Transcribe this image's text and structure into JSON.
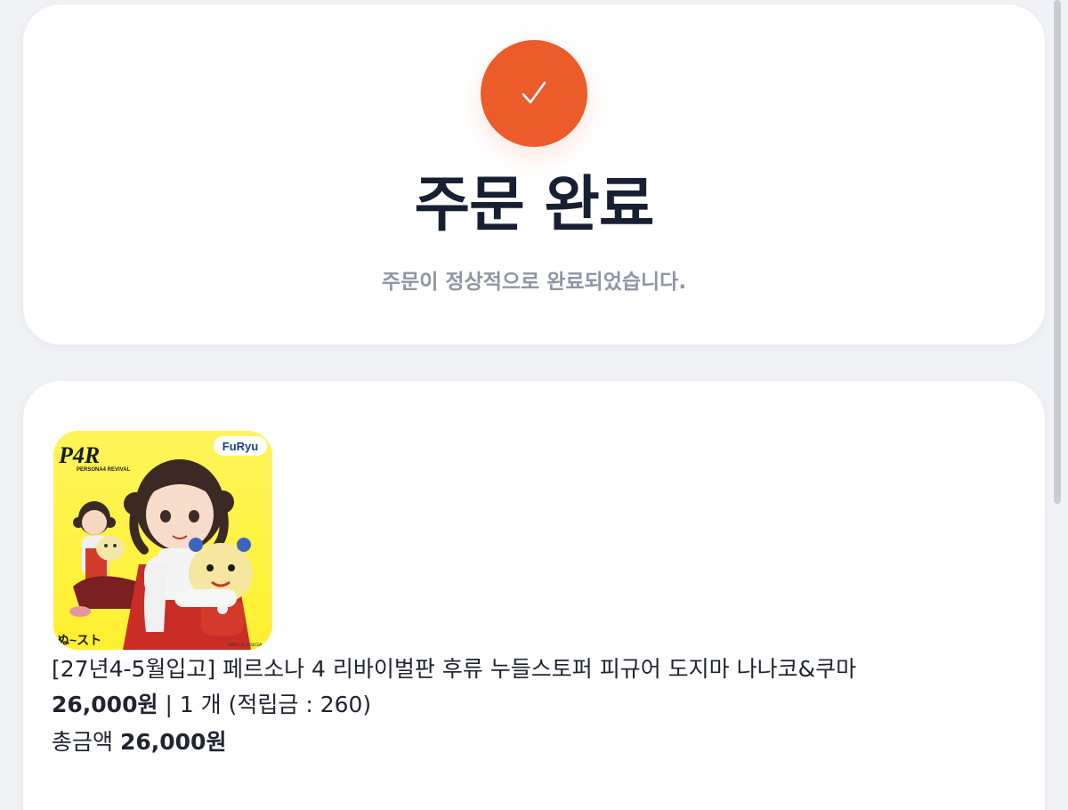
{
  "status": {
    "accent_color": "#ec5b2a",
    "check_icon": "checkmark-icon",
    "title": "주문 완료",
    "message": "주문이 정상적으로 완료되었습니다."
  },
  "order": {
    "item": {
      "name": "[27년4-5월입고] 페르소나 4 리바이벌판 후류 누들스토퍼 피규어 도지마 나나코&쿠마",
      "price": "26,000원",
      "separator": "|",
      "quantity": "1 개",
      "points": "(적립금 : 260)",
      "image_logo_left": "P4R",
      "image_logo_left_sub": "PERSONA4 REVIVAL",
      "image_logo_right": "FuRyu",
      "image_brand_bottom": "ぬ~スト",
      "image_copyright": "©ATLUS ©SEGA"
    },
    "total_label": "총금액",
    "total_value": "26,000원"
  }
}
